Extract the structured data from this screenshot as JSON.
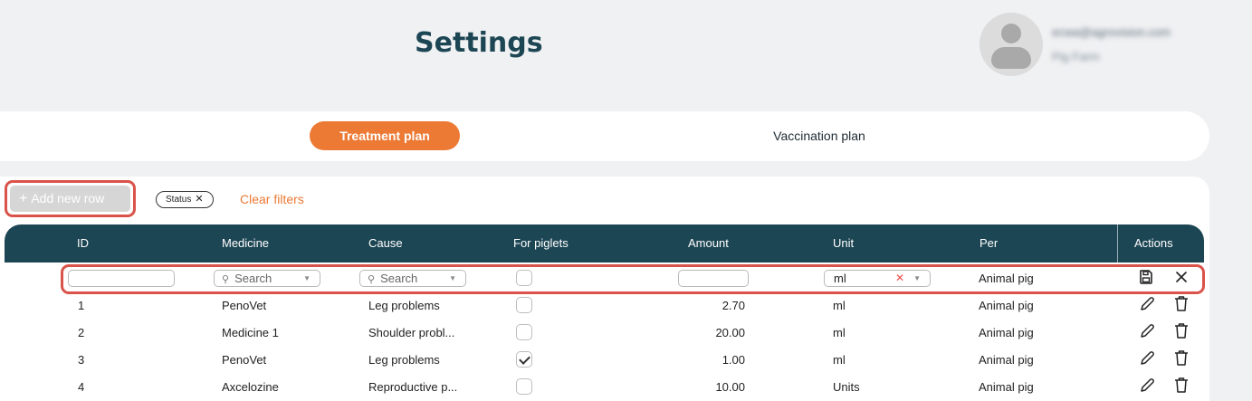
{
  "header": {
    "title": "Settings",
    "user_email": "ecwa@agrovision.com",
    "user_farm": "Pig Farm"
  },
  "tabs": [
    {
      "label": "Treatment plan",
      "active": true
    },
    {
      "label": "Vaccination plan",
      "active": false
    }
  ],
  "toolbar": {
    "add_label": "Add new row",
    "status_chip": "Status",
    "clear_filters": "Clear filters"
  },
  "table": {
    "columns": [
      "ID",
      "Medicine",
      "Cause",
      "For piglets",
      "Amount",
      "Unit",
      "Per",
      "Actions"
    ],
    "filter_row": {
      "medicine_placeholder": "Search",
      "cause_placeholder": "Search",
      "unit_value": "ml",
      "per_value": "Animal pig"
    },
    "rows": [
      {
        "id": "1",
        "medicine": "PenoVet",
        "cause": "Leg problems",
        "for_piglets": false,
        "amount": "2.70",
        "unit": "ml",
        "per": "Animal pig"
      },
      {
        "id": "2",
        "medicine": "Medicine 1",
        "cause": "Shoulder probl...",
        "for_piglets": false,
        "amount": "20.00",
        "unit": "ml",
        "per": "Animal pig"
      },
      {
        "id": "3",
        "medicine": "PenoVet",
        "cause": "Leg problems",
        "for_piglets": true,
        "amount": "1.00",
        "unit": "ml",
        "per": "Animal pig"
      },
      {
        "id": "4",
        "medicine": "Axcelozine",
        "cause": "Reproductive p...",
        "for_piglets": false,
        "amount": "10.00",
        "unit": "Units",
        "per": "Animal pig"
      }
    ]
  },
  "colors": {
    "accent": "#ec7a35",
    "header_bg": "#1d4654",
    "highlight": "#d9534a"
  },
  "icons": [
    "search-icon",
    "chevron-down-icon",
    "clear-icon",
    "save-icon",
    "cancel-icon",
    "edit-icon",
    "delete-icon",
    "plus-icon"
  ]
}
